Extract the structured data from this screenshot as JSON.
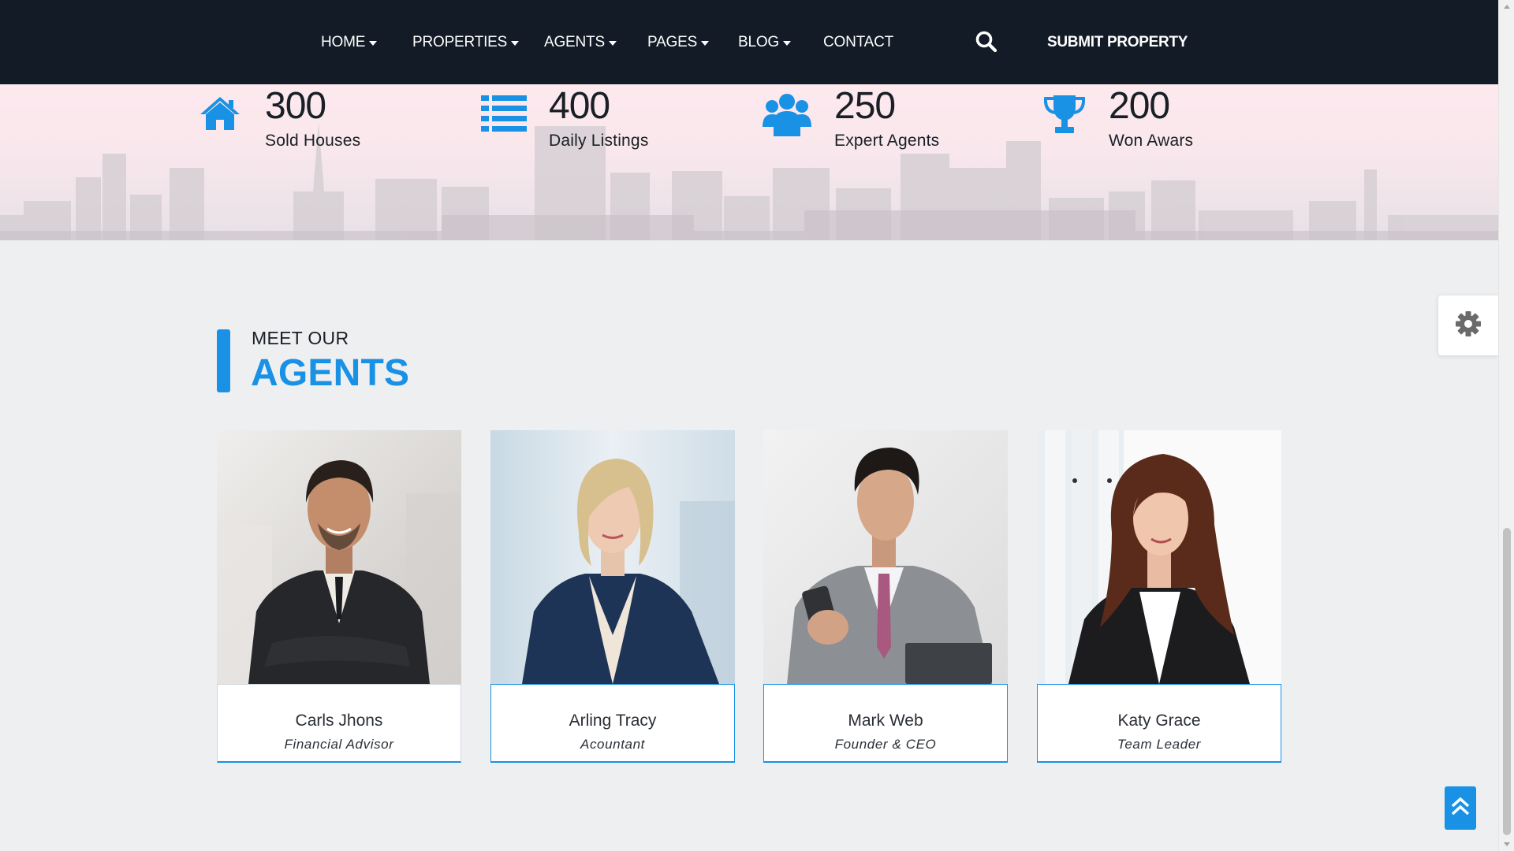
{
  "nav": {
    "items": [
      {
        "label": "HOME",
        "has_dropdown": true
      },
      {
        "label": "PROPERTIES",
        "has_dropdown": true
      },
      {
        "label": "AGENTS",
        "has_dropdown": true
      },
      {
        "label": "PAGES",
        "has_dropdown": true
      },
      {
        "label": "BLOG",
        "has_dropdown": true
      },
      {
        "label": "CONTACT",
        "has_dropdown": false
      }
    ],
    "search_icon": "search-icon",
    "submit_label": "SUBMIT PROPERTY"
  },
  "stats": [
    {
      "icon": "house-icon",
      "number": "300",
      "label": "Sold Houses"
    },
    {
      "icon": "list-icon",
      "number": "400",
      "label": "Daily Listings"
    },
    {
      "icon": "users-icon",
      "number": "250",
      "label": "Expert Agents"
    },
    {
      "icon": "trophy-icon",
      "number": "200",
      "label": "Won Awars"
    }
  ],
  "agents_section": {
    "subtitle": "MEET OUR",
    "title": "AGENTS",
    "agents": [
      {
        "name": "Carls Jhons",
        "role": "Financial Advisor"
      },
      {
        "name": "Arling Tracy",
        "role": "Acountant"
      },
      {
        "name": "Mark Web",
        "role": "Founder & CEO"
      },
      {
        "name": "Katy Grace",
        "role": "Team Leader"
      }
    ]
  },
  "widgets": {
    "settings_icon": "gear-icon",
    "scroll_top_icon": "double-chevron-up-icon"
  },
  "colors": {
    "nav_bg": "#121b26",
    "accent": "#1991e4",
    "page_bg": "#eeeff1"
  }
}
